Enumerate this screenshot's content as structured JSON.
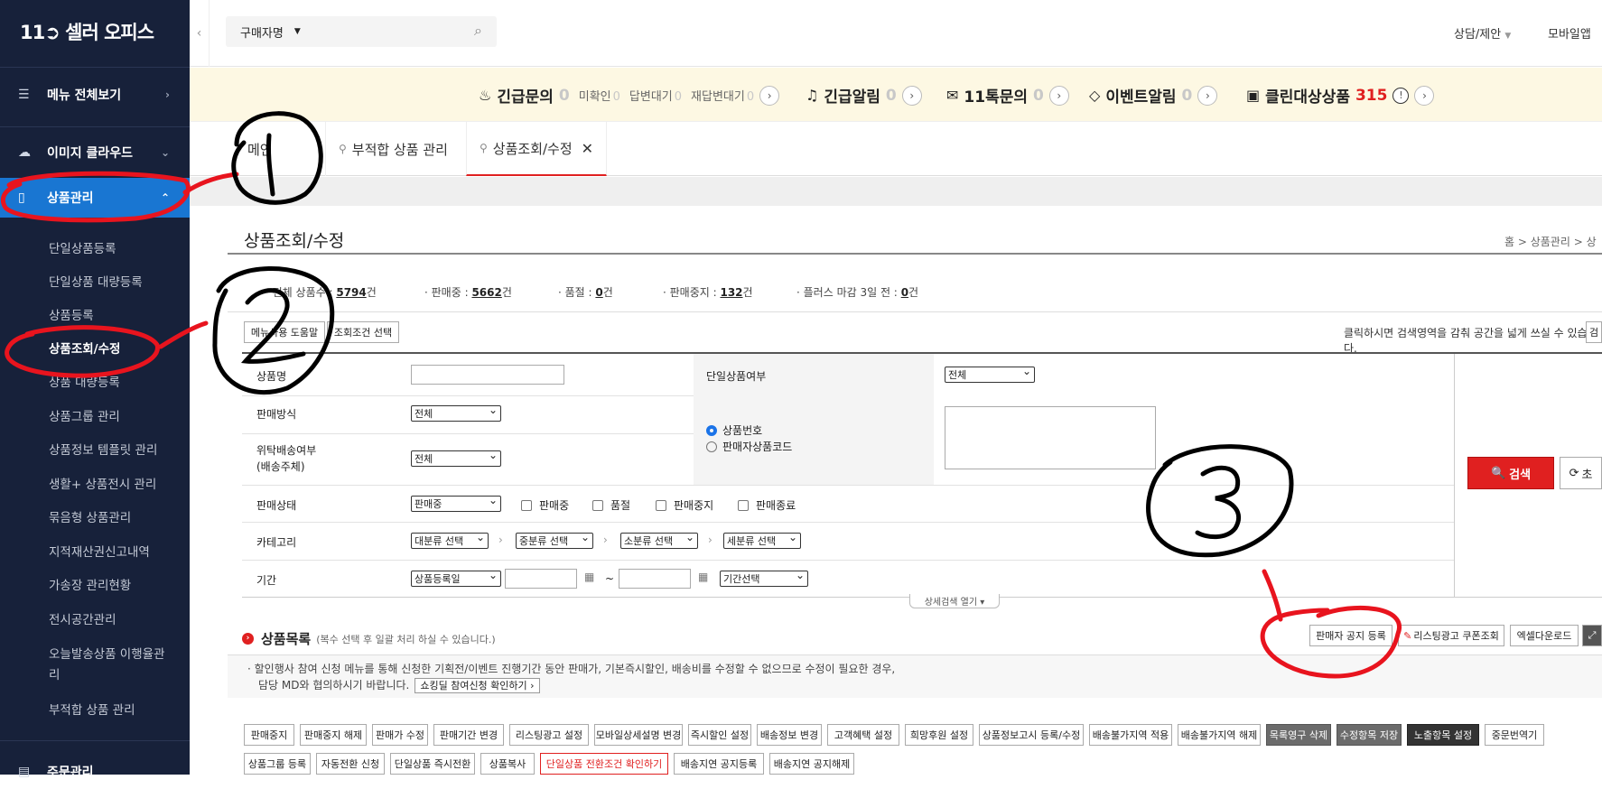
{
  "sidebar": {
    "logo": "11➲ 셀러 오피스",
    "menu_all": "메뉴 전체보기",
    "image_cloud": "이미지 클라우드",
    "product_mgmt": "상품관리",
    "items": [
      "단일상품등록",
      "단일상품 대량등록",
      "상품등록",
      "상품조회/수정",
      "상품 대량등록",
      "상품그룹 관리",
      "상품정보 템플릿 관리",
      "생활+ 상품전시 관리",
      "묶음형 상품관리",
      "지적재산권신고내역",
      "가송장 관리현황",
      "전시공간관리",
      "오늘발송상품 이행율관",
      "리",
      "부적합 상품 관리"
    ],
    "order_mgmt": "주문관리"
  },
  "topbar": {
    "search_type": "구매자명",
    "consult": "상담/제안",
    "mobile_app": "모바일앱"
  },
  "notice": {
    "urgent_inquiry": "긴급문의",
    "urgent_inquiry_count": "0",
    "unconfirmed": "미확인",
    "unconfirmed_count": "0",
    "awaiting_reply": "답변대기",
    "awaiting_reply_count": "0",
    "awaiting_re_reply": "재답변대기",
    "awaiting_re_reply_count": "0",
    "urgent_alert": "긴급알림",
    "urgent_alert_count": "0",
    "talk": "11톡문의",
    "talk_count": "0",
    "event_alert": "이벤트알림",
    "event_alert_count": "0",
    "clean_target": "클린대상상품",
    "clean_target_count": "315"
  },
  "tabs": [
    "메인",
    "부적합 상품 관리",
    "상품조회/수정"
  ],
  "page": {
    "title": "상품조회/수정",
    "breadcrumb": "홈  >  상품관리  >  상"
  },
  "stats": {
    "total_label": "· 전체 상품수 :",
    "total": "5794",
    "on_sale_label": "· 판매중 :",
    "on_sale": "5662",
    "sold_out_label": "· 품절 :",
    "sold_out": "0",
    "stopped_label": "· 판매중지 :",
    "stopped": "132",
    "plus_label": "· 플러스 마감 3일 전 :",
    "plus": "0",
    "unit": "건"
  },
  "toolbar": {
    "help": "메뉴사용 도움말",
    "condition": "조회조건 선택",
    "hint": "클릭하시면 검색영역을 감춰 공간을 넓게 쓰실 수 있습니다.",
    "hint_btn": "검"
  },
  "form": {
    "product_name": "상품명",
    "single_flag": "단일상품여부",
    "single_flag_value": "전체",
    "sale_method": "판매방식",
    "sale_method_value": "전체",
    "radio_product_no": "상품번호",
    "radio_seller_code": "판매자상품코드",
    "consign_l1": "위탁배송여부",
    "consign_l2": "(배송주체)",
    "consign_value": "전체",
    "status": "판매상태",
    "status_value": "판매중",
    "status_opts": [
      "판매중",
      "품절",
      "판매중지",
      "판매종료"
    ],
    "category": "카테고리",
    "cat_values": [
      "대분류 선택",
      "중분류 선택",
      "소분류 선택",
      "세분류 선택"
    ],
    "period": "기간",
    "period_type": "상품등록일",
    "tilde": "~",
    "period_select": "기간선택",
    "search": "검색",
    "reset": "초",
    "detail_toggle": "상세검색 열기"
  },
  "list": {
    "title": "상품목록",
    "subtitle": "(복수 선택 후 일괄 처리 하실 수 있습니다.)",
    "seller_notice": "판매자 공지 등록",
    "listing_ad": "리스팅광고 쿠폰조회",
    "excel": "엑셀다운로드",
    "notice_l1": "· 할인행사 참여 신청 메뉴를 통해 신청한 기획전/이벤트 진행기간 동안 판매가, 기본즉시할인, 배송비를 수정할 수 없으므로 수정이 필요한 경우,",
    "notice_l2": "담당 MD와 협의하시기 바랍니다.",
    "notice_link": "쇼킹딜 참여신청 확인하기 ›"
  },
  "actions_row1": [
    "판매중지",
    "판매중지 해제",
    "판매가 수정",
    "판매기간 변경",
    "리스팅광고 설정",
    "모바일상세설명 변경",
    "즉시할인 설정",
    "배송정보 변경",
    "고객혜택 설정",
    "희망후원 설정",
    "상품정보고시 등록/수정",
    "배송불가지역 적용",
    "배송불가지역 해제",
    "목록영구 삭제",
    "수정항목 저장",
    "노출항목 설정",
    "중문번역기"
  ],
  "actions_row2": [
    "상품그룹 등록",
    "자동전환 신청",
    "단일상품 즉시전환",
    "상품복사",
    "단일상품 전환조건 확인하기",
    "배송지연 공지등록",
    "배송지연 공지해제"
  ],
  "annotations": [
    "1",
    "2",
    "3"
  ],
  "colors": {
    "sidebar": "#17213a",
    "active": "#1976d2",
    "accent": "#e02020",
    "notice_bg": "#fdf8e3",
    "annotation_red": "#e8141e"
  }
}
